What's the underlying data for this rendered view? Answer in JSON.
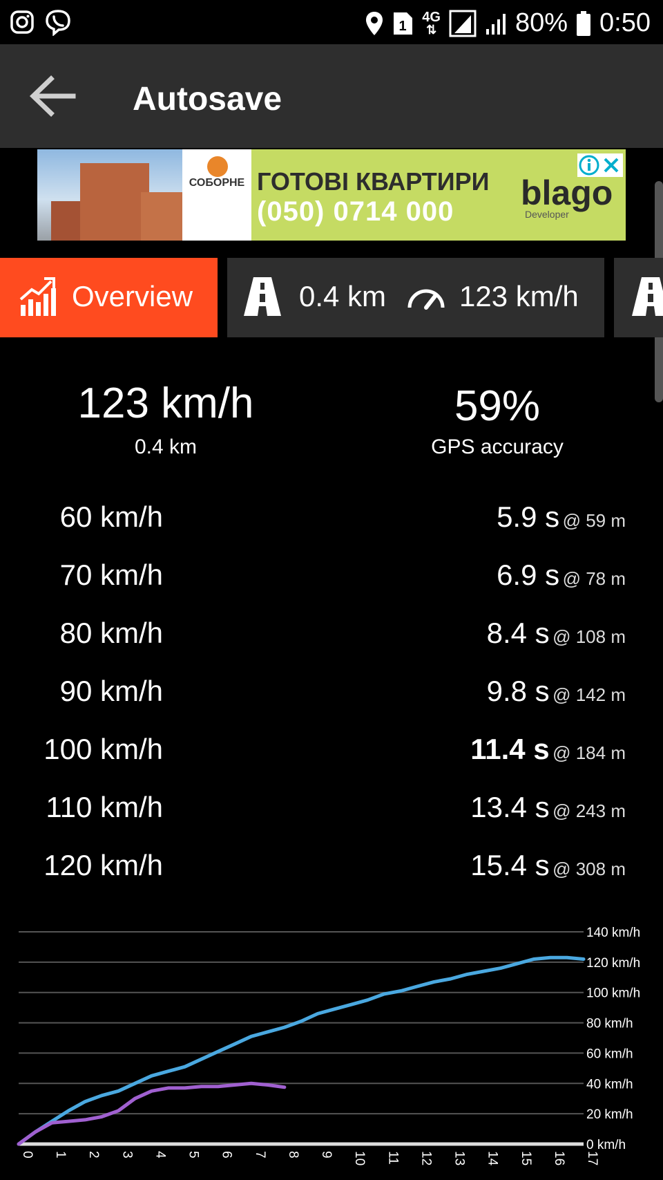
{
  "status_bar": {
    "battery": "80%",
    "time": "0:50",
    "sim_slot": "1",
    "network": "4G",
    "icons": [
      "instagram-icon",
      "viber-icon",
      "location-icon",
      "sim-icon",
      "network-4g-icon",
      "signal-icon",
      "signal-icon",
      "battery-icon"
    ]
  },
  "app_bar": {
    "title": "Autosave",
    "back_icon": "arrow-back-icon"
  },
  "ad": {
    "brand": "СОБОРНЕ",
    "headline": "ГОТОВІ КВАРТИРИ",
    "phone": "(050) 0714 000",
    "logo": "blago",
    "logo_sub": "Developer",
    "colors": {
      "background": "#c5db63",
      "close": "#00aecd"
    }
  },
  "tabs": {
    "overview": {
      "label": "Overview",
      "icon": "chart-up-icon"
    },
    "run": {
      "distance": "0.4 km",
      "speed": "123 km/h",
      "road_icon": "road-icon",
      "speed_icon": "speedometer-icon"
    },
    "next_icon": "road-icon"
  },
  "summary": {
    "top_speed": "123 km/h",
    "distance": "0.4 km",
    "gps_accuracy": "59%",
    "gps_label": "GPS accuracy"
  },
  "results": [
    {
      "target": "60 km/h",
      "time": "5.9 s",
      "distance": "@ 59 m",
      "bold": false
    },
    {
      "target": "70 km/h",
      "time": "6.9 s",
      "distance": "@ 78 m",
      "bold": false
    },
    {
      "target": "80 km/h",
      "time": "8.4 s",
      "distance": "@ 108 m",
      "bold": false
    },
    {
      "target": "90 km/h",
      "time": "9.8 s",
      "distance": "@ 142 m",
      "bold": false
    },
    {
      "target": "100 km/h",
      "time": "11.4 s",
      "distance": "@ 184 m",
      "bold": true
    },
    {
      "target": "110 km/h",
      "time": "13.4 s",
      "distance": "@ 243 m",
      "bold": false
    },
    {
      "target": "120 km/h",
      "time": "15.4 s",
      "distance": "@ 308 m",
      "bold": false
    }
  ],
  "colors": {
    "accent": "#ff4b1f",
    "tab_bg": "#2e2e2e",
    "speed_line": "#4aa8e0",
    "accel_line": "#a060d0"
  },
  "chart_data": {
    "type": "line",
    "x": [
      0,
      1,
      2,
      3,
      4,
      5,
      6,
      7,
      8,
      9,
      10,
      11,
      12,
      13,
      14,
      15,
      16,
      17
    ],
    "x_ticks": [
      "0",
      "1",
      "2",
      "3",
      "4",
      "5",
      "6",
      "7",
      "8",
      "9",
      "10",
      "11",
      "12",
      "13",
      "14",
      "15",
      "16",
      "17"
    ],
    "y_ticks": [
      "0 km/h",
      "20 km/h",
      "40 km/h",
      "60 km/h",
      "80 km/h",
      "100 km/h",
      "120 km/h",
      "140 km/h"
    ],
    "ylim": [
      0,
      140
    ],
    "xlim": [
      0,
      17
    ],
    "grid": true,
    "series": [
      {
        "color": "#4aa8e0",
        "points": [
          [
            0,
            0
          ],
          [
            0.5,
            8
          ],
          [
            1,
            15
          ],
          [
            1.5,
            22
          ],
          [
            2,
            28
          ],
          [
            2.5,
            32
          ],
          [
            3,
            35
          ],
          [
            3.5,
            40
          ],
          [
            4,
            45
          ],
          [
            4.5,
            48
          ],
          [
            5,
            51
          ],
          [
            5.5,
            56
          ],
          [
            6,
            61
          ],
          [
            6.5,
            66
          ],
          [
            7,
            71
          ],
          [
            7.5,
            74
          ],
          [
            8,
            77
          ],
          [
            8.5,
            81
          ],
          [
            9,
            86
          ],
          [
            9.5,
            89
          ],
          [
            10,
            92
          ],
          [
            10.5,
            95
          ],
          [
            11,
            99
          ],
          [
            11.5,
            101
          ],
          [
            12,
            104
          ],
          [
            12.5,
            107
          ],
          [
            13,
            109
          ],
          [
            13.5,
            112
          ],
          [
            14,
            114
          ],
          [
            14.5,
            116
          ],
          [
            15,
            119
          ],
          [
            15.5,
            122
          ],
          [
            16,
            123
          ],
          [
            16.5,
            123
          ],
          [
            17,
            122
          ]
        ]
      },
      {
        "color": "#a060d0",
        "points": [
          [
            0,
            0
          ],
          [
            0.5,
            8
          ],
          [
            1,
            14
          ],
          [
            1.5,
            15
          ],
          [
            2,
            16
          ],
          [
            2.5,
            18
          ],
          [
            3,
            22
          ],
          [
            3.5,
            30
          ],
          [
            4,
            35
          ],
          [
            4.5,
            37
          ],
          [
            5,
            37
          ],
          [
            5.5,
            38
          ],
          [
            6,
            38
          ],
          [
            6.5,
            39
          ],
          [
            7,
            40
          ],
          [
            7.5,
            39
          ],
          [
            8,
            37.5
          ]
        ]
      }
    ]
  }
}
